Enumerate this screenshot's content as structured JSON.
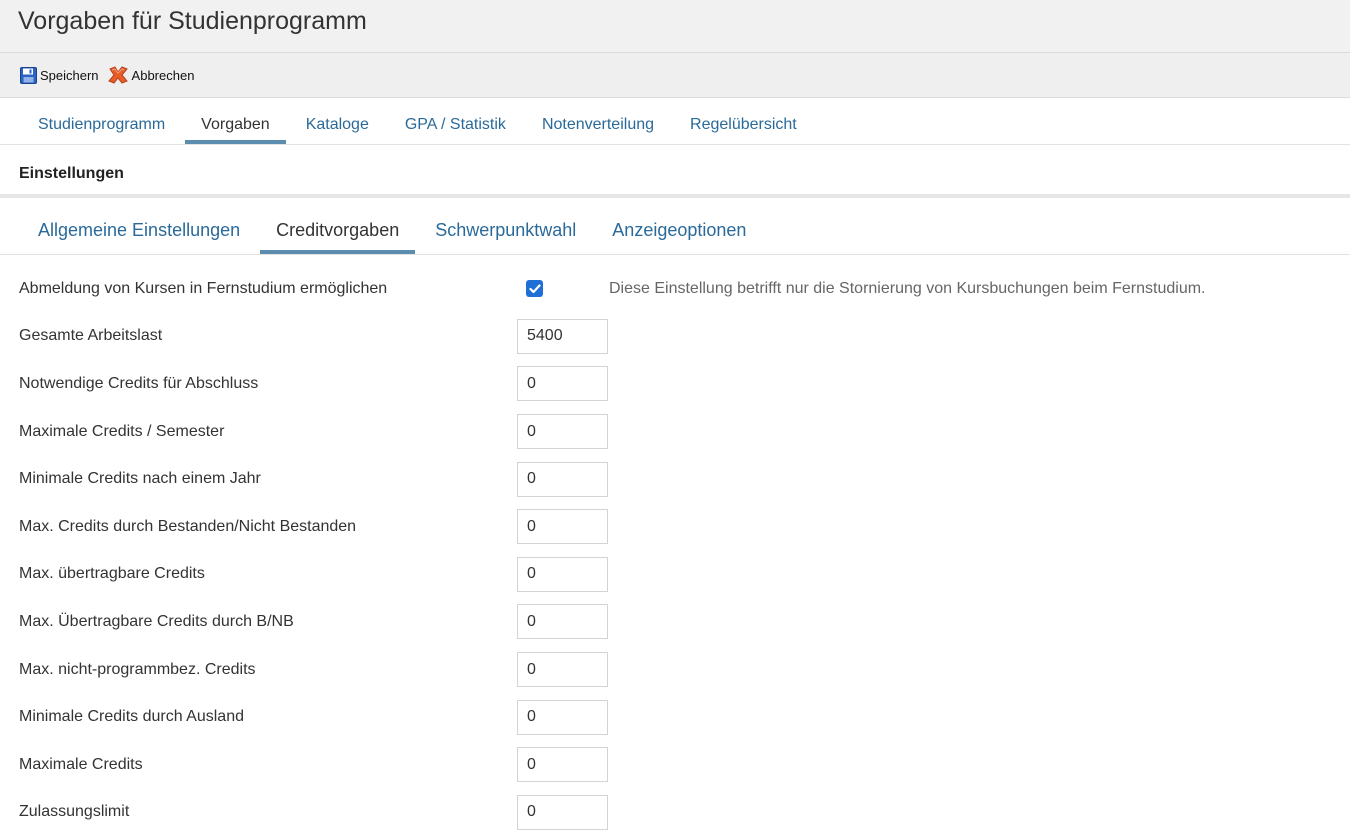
{
  "window": {
    "title": "Vorgaben für Studienprogramm"
  },
  "toolbar": {
    "save_label": "Speichern",
    "cancel_label": "Abbrechen"
  },
  "main_tabs": [
    {
      "label": "Studienprogramm",
      "active": false
    },
    {
      "label": "Vorgaben",
      "active": true
    },
    {
      "label": "Kataloge",
      "active": false
    },
    {
      "label": "GPA / Statistik",
      "active": false
    },
    {
      "label": "Notenverteilung",
      "active": false
    },
    {
      "label": "Regelübersicht",
      "active": false
    }
  ],
  "section": {
    "title": "Einstellungen"
  },
  "sub_tabs": [
    {
      "label": "Allgemeine Einstellungen",
      "active": false
    },
    {
      "label": "Creditvorgaben",
      "active": true
    },
    {
      "label": "Schwerpunktwahl",
      "active": false
    },
    {
      "label": "Anzeigeoptionen",
      "active": false
    }
  ],
  "form": {
    "distance_cancel": {
      "label": "Abmeldung von Kursen in Fernstudium ermöglichen",
      "checked": true,
      "hint": "Diese Einstellung betrifft nur die Stornierung von Kursbuchungen beim Fernstudium."
    },
    "fields": [
      {
        "label": "Gesamte Arbeitslast",
        "value": "5400"
      },
      {
        "label": "Notwendige Credits für Abschluss",
        "value": "0"
      },
      {
        "label": "Maximale Credits / Semester",
        "value": "0"
      },
      {
        "label": "Minimale Credits nach einem Jahr",
        "value": "0"
      },
      {
        "label": "Max. Credits durch Bestanden/Nicht Bestanden",
        "value": "0"
      },
      {
        "label": "Max. übertragbare Credits",
        "value": "0"
      },
      {
        "label": "Max. Übertragbare Credits durch B/NB",
        "value": "0"
      },
      {
        "label": "Max. nicht-programmbez. Credits",
        "value": "0"
      },
      {
        "label": "Minimale Credits durch Ausland",
        "value": "0"
      },
      {
        "label": "Maximale Credits",
        "value": "0"
      },
      {
        "label": "Zulassungslimit",
        "value": "0"
      }
    ]
  },
  "colors": {
    "tab_link": "#2a6a9a",
    "tab_active_underline": "#5d8dae",
    "checkbox": "#1f6fd6"
  },
  "icons": {
    "save": "floppy-disk-icon",
    "cancel": "cross-icon",
    "check": "checkmark-icon"
  }
}
